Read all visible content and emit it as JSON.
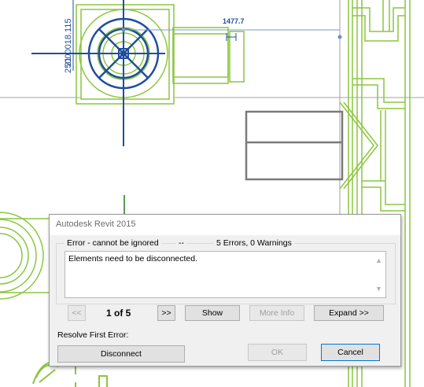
{
  "drawing": {
    "dim_vertical_label": "25000018.115",
    "dim_overlap_label": "21",
    "dim_horizontal_label": "1477.7"
  },
  "dialog": {
    "title": "Autodesk Revit 2015",
    "group_left": "Error - cannot be ignored",
    "group_mid": "--",
    "group_right": "5 Errors, 0 Warnings",
    "message": "Elements need to be disconnected.",
    "prev_label": "<<",
    "counter": "1 of 5",
    "next_label": ">>",
    "show_label": "Show",
    "more_info_label": "More Info",
    "expand_label": "Expand >>",
    "resolve_label": "Resolve First Error:",
    "disconnect_label": "Disconnect",
    "ok_label": "OK",
    "cancel_label": "Cancel"
  },
  "colors": {
    "geometry": "#8cc63f",
    "selection": "#1f4e9c",
    "dialog_bg": "#f0f0f0"
  }
}
